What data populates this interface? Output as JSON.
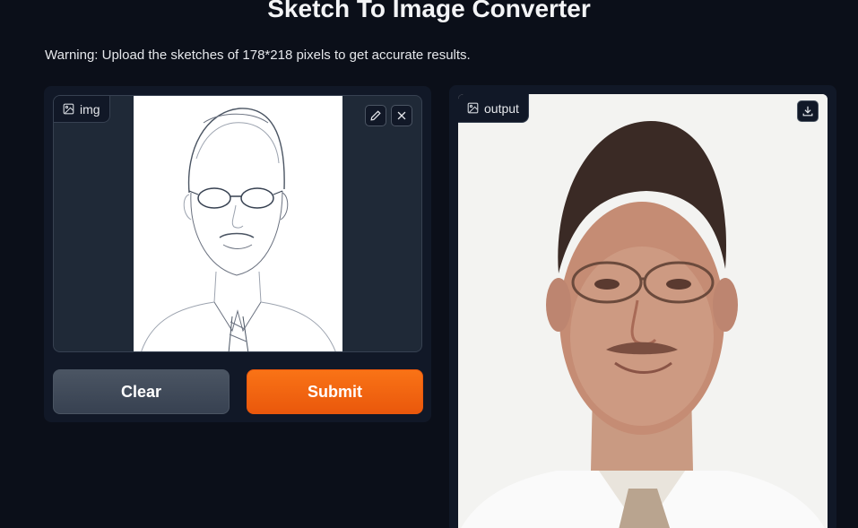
{
  "header": {
    "title": "Sketch To Image Converter",
    "warning": "Warning: Upload the sketches of 178*218 pixels to get accurate results."
  },
  "input": {
    "label": "img",
    "label_icon": "image-icon",
    "edit_icon": "pencil-icon",
    "clear_icon": "close-icon"
  },
  "actions": {
    "clear_label": "Clear",
    "submit_label": "Submit"
  },
  "output": {
    "label": "output",
    "label_icon": "image-icon",
    "download_icon": "download-icon"
  },
  "colors": {
    "background": "#0b0f19",
    "panel": "#111827",
    "accent": "#f97316",
    "secondary_button": "#4b5563"
  }
}
